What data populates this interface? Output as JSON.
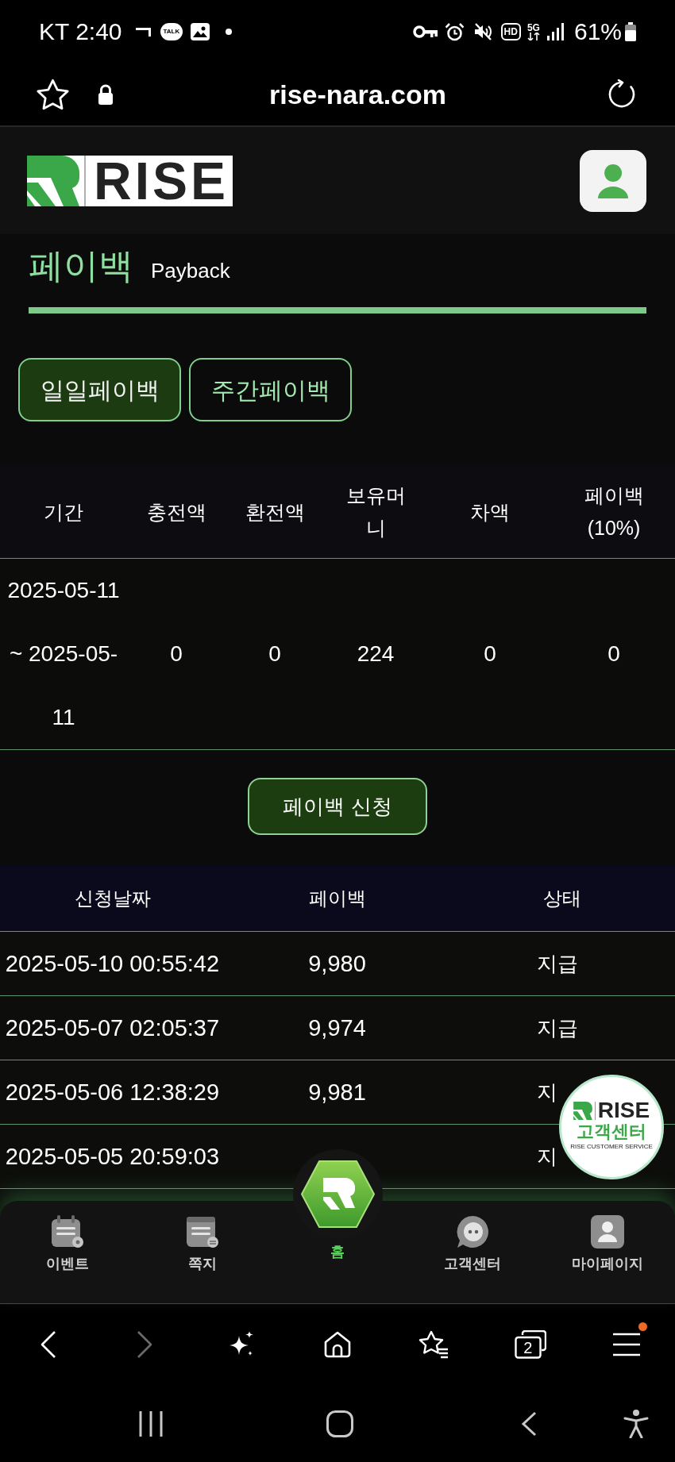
{
  "status_bar": {
    "carrier_time": "KT 2:40",
    "talk_badge": "TALK",
    "hd_badge": "HD",
    "network": "5G",
    "battery": "61%"
  },
  "browser": {
    "url": "rise-nara.com",
    "forward_disabled": true,
    "tab_count": "2",
    "menu_has_notification": true
  },
  "header": {
    "logo_text": "RISE"
  },
  "page_title": {
    "title": "페이백",
    "subtitle": "Payback"
  },
  "tabs": [
    {
      "label": "일일페이백",
      "selected": true
    },
    {
      "label": "주간페이백",
      "selected": false
    }
  ],
  "summary_table": {
    "columns": [
      "기간",
      "충전액",
      "환전액",
      "보유머니",
      "차액",
      "페이백(10%)"
    ],
    "rows": [
      [
        "2025-05-11 ~ 2025-05-11",
        "0",
        "0",
        "224",
        "0",
        "0"
      ]
    ]
  },
  "apply_button": {
    "label": "페이백 신청"
  },
  "history_table": {
    "columns": [
      "신청날짜",
      "페이백",
      "상태"
    ],
    "rows": [
      {
        "date": "2025-05-10 00:55:42",
        "payback": "9,980",
        "status": "지급"
      },
      {
        "date": "2025-05-07 02:05:37",
        "payback": "9,974",
        "status": "지급"
      },
      {
        "date": "2025-05-06 12:38:29",
        "payback": "9,981",
        "status": "지"
      },
      {
        "date": "2025-05-05 20:59:03",
        "status": "지"
      }
    ]
  },
  "bottom_nav": [
    {
      "kind": "calendar",
      "label": "이벤트",
      "selected": false
    },
    {
      "kind": "notepad",
      "label": "쪽지",
      "selected": false
    },
    {
      "kind": "home",
      "label": "홈",
      "selected": true
    },
    {
      "kind": "chat",
      "label": "고객센터",
      "selected": false
    },
    {
      "kind": "user",
      "label": "마이페이지",
      "selected": false
    }
  ],
  "support_button": {
    "brand": "RISE",
    "title": "고객센터",
    "caption": "RISE CUSTOMER SERVICE"
  }
}
